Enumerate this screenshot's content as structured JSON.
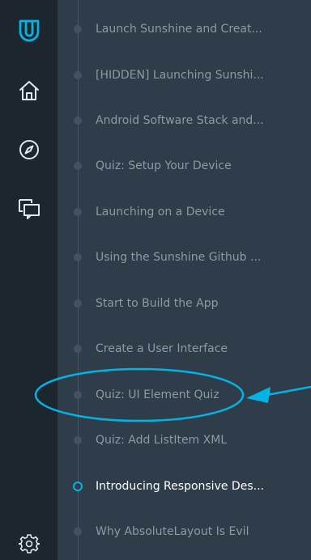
{
  "rail": {
    "icons": [
      "udacity-logo-icon",
      "home-icon",
      "compass-icon",
      "chat-icon",
      "gear-icon"
    ],
    "accent": "#02b3e4"
  },
  "lessons": [
    {
      "label": "Launch Sunshine and Creat...",
      "active": false
    },
    {
      "label": "[HIDDEN] Launching Sunshi...",
      "active": false
    },
    {
      "label": "Android Software Stack and...",
      "active": false
    },
    {
      "label": "Quiz: Setup Your Device",
      "active": false
    },
    {
      "label": "Launching on a Device",
      "active": false
    },
    {
      "label": "Using the Sunshine Github ...",
      "active": false
    },
    {
      "label": "Start to Build the App",
      "active": false
    },
    {
      "label": "Create a User Interface",
      "active": false
    },
    {
      "label": "Quiz: UI Element Quiz",
      "active": false
    },
    {
      "label": "Quiz: Add ListItem XML",
      "active": false
    },
    {
      "label": "Introducing Responsive Des...",
      "active": true
    },
    {
      "label": "Why AbsoluteLayout Is Evil",
      "active": false
    }
  ],
  "annotation": {
    "highlight_color": "#02b3e4",
    "target": "Quiz: UI Element Quiz"
  }
}
